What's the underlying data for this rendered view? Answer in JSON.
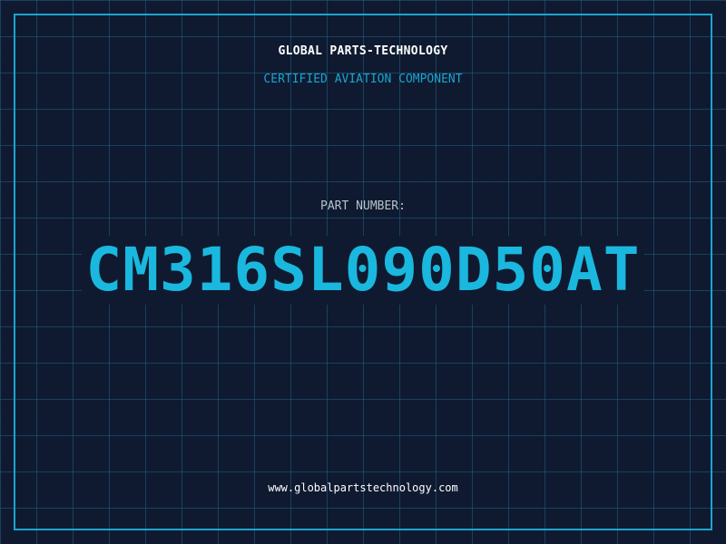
{
  "header": {
    "company": "GLOBAL PARTS-TECHNOLOGY",
    "subtitle": "CERTIFIED AVIATION COMPONENT"
  },
  "part": {
    "label": "PART NUMBER:",
    "number": "CM316SL090D50AT"
  },
  "footer": {
    "website": "www.globalpartstechnology.com"
  },
  "colors": {
    "background": "#0f1a30",
    "accent": "#1ab8de",
    "frame": "#1ba4d0",
    "label": "#b8c2cc",
    "text": "#ffffff"
  }
}
